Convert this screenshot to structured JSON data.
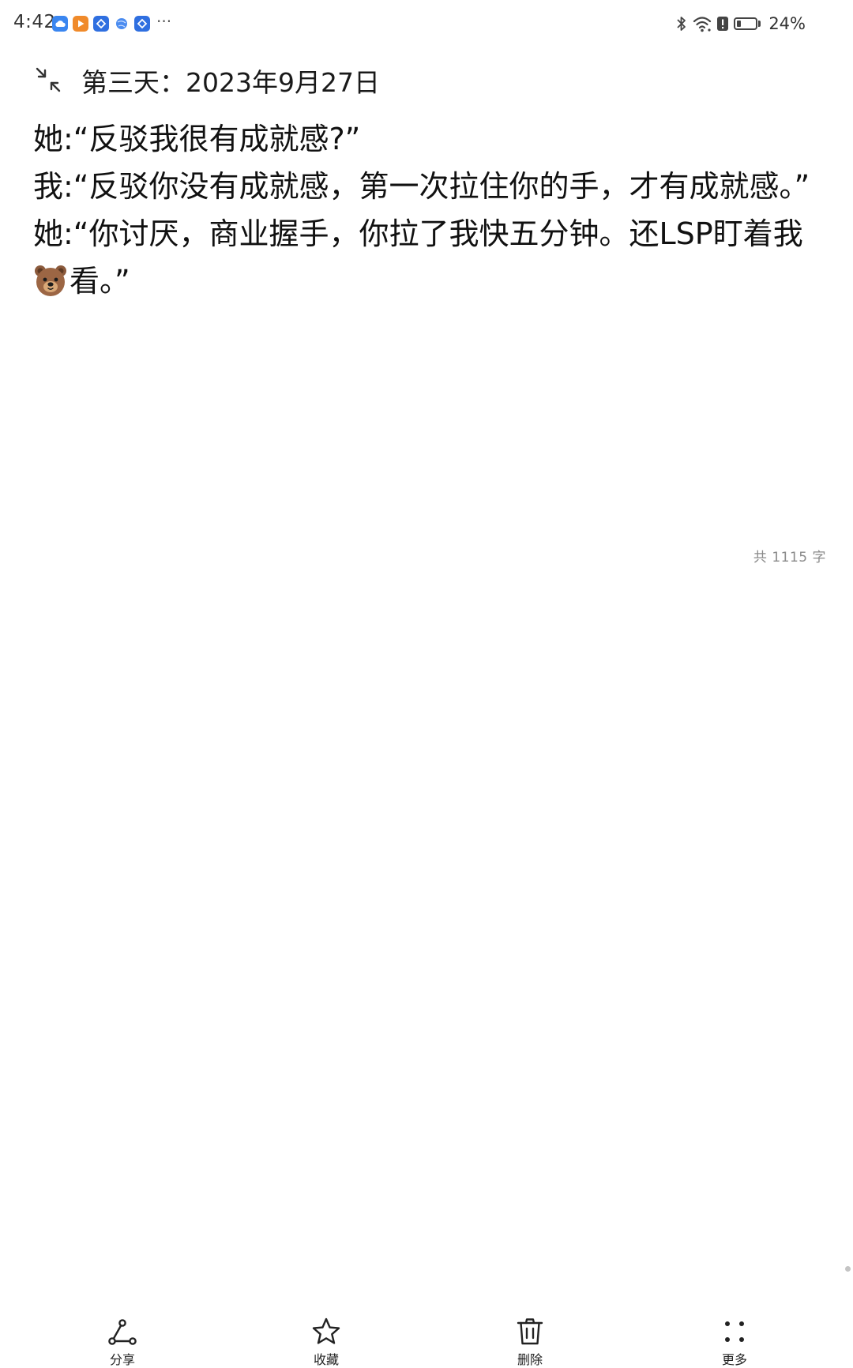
{
  "status_bar": {
    "time": "4:42",
    "more": "···",
    "battery_level": 0.24,
    "battery_text": "24%",
    "app_icons": [
      {
        "name": "cloud-app-icon",
        "color": "#3a86f0"
      },
      {
        "name": "video-app-icon",
        "color": "#f08a2a"
      },
      {
        "name": "house-app-icon",
        "color": "#2f6fe0"
      },
      {
        "name": "globe-app-icon",
        "color": "#4b8cf0"
      },
      {
        "name": "house-app-icon",
        "color": "#2f6fe0"
      }
    ]
  },
  "note": {
    "title": "第三天：2023年9月27日",
    "lines": [
      "她:“反驳我很有成就感?”",
      "我:“反驳你没有成就感，第一次拉住你的手，才有成就感。”",
      "她:“你讨厌，商业握手，你拉了我快五分钟。还LSP盯着我",
      "看。”"
    ],
    "emoji": "bear-face",
    "word_count": "共 1115 字"
  },
  "toolbar": {
    "share": "分享",
    "favorite": "收藏",
    "delete": "删除",
    "more": "更多"
  }
}
